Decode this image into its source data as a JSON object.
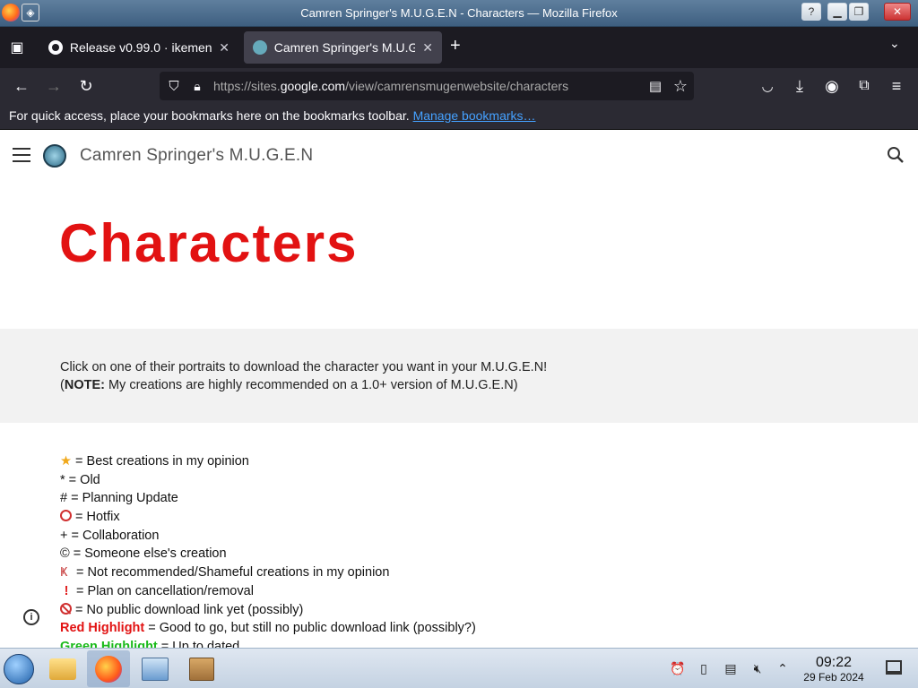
{
  "window": {
    "title": "Camren Springer's M.U.G.E.N - Characters — Mozilla Firefox"
  },
  "tabs": [
    {
      "label": "Release v0.99.0 · ikemen",
      "icon": "github-icon"
    },
    {
      "label": "Camren Springer's M.U.G.",
      "icon": "site-favicon"
    }
  ],
  "navbar": {
    "url_prefix": "https://sites.",
    "url_domain": "google.com",
    "url_path": "/view/camrensmugenwebsite/characters"
  },
  "bookmarks_bar": {
    "message": "For quick access, place your bookmarks here on the bookmarks toolbar. ",
    "link": "Manage bookmarks…"
  },
  "site": {
    "name": "Camren Springer's M.U.G.E.N",
    "page_title": "Characters",
    "intro_line1": "Click on one of their portraits to download the character you want in your M.U.G.E.N!",
    "intro_note_label": "NOTE:",
    "intro_note_open": "(",
    "intro_note_text": " My creations are highly recommended on a 1.0+ version of M.U.G.E.N)"
  },
  "legend": {
    "star": " = Best creations in my opinion",
    "old": "* = Old",
    "planning": "# = Planning Update",
    "hotfix": " = Hotfix",
    "collab": "+ = Collaboration",
    "someone": "© = Someone else's creation",
    "not_recommended": " = Not recommended/Shameful creations in my opinion",
    "cancellation": " = Plan on cancellation/removal",
    "no_link": " = No public download link yet (possibly)",
    "red_label": "Red Highlight",
    "red_text": " = Good to go, but still no public download link (possibly?)",
    "green_label": "Green Highlight",
    "green_text": " = Up to dated"
  },
  "taskbar": {
    "time": "09:22",
    "date": "29 Feb 2024"
  },
  "colors": {
    "title_red": "#e21212",
    "highlight_green": "#1aba1a",
    "link_blue": "#45a1ff"
  }
}
